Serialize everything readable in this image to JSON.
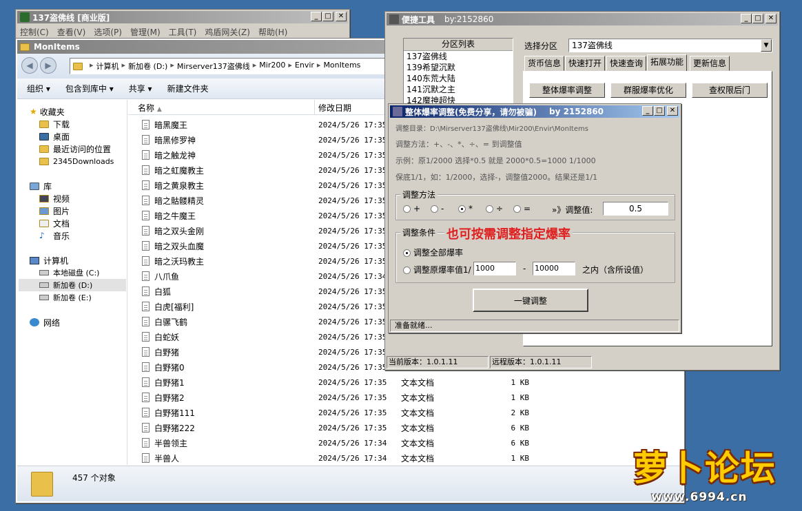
{
  "back_window": {
    "title": "137盗佛线 [商业版]",
    "menu": [
      "控制(C)",
      "查看(V)",
      "选项(P)",
      "管理(M)",
      "工具(T)",
      "鸡盾网关(Z)",
      "帮助(H)"
    ]
  },
  "explorer": {
    "title": "MonItems",
    "path": [
      "计算机",
      "新加卷 (D:)",
      "Mirserver137盗佛线",
      "Mir200",
      "Envir",
      "MonItems"
    ],
    "toolbar": {
      "organize": "组织",
      "include": "包含到库中",
      "share": "共享",
      "new_folder": "新建文件夹"
    },
    "col_name": "名称",
    "col_date": "修改日期",
    "nav": {
      "favorites": "收藏夹",
      "fav_items": [
        "下载",
        "桌面",
        "最近访问的位置",
        "2345Downloads"
      ],
      "libraries": "库",
      "lib_items": [
        "视频",
        "图片",
        "文档",
        "音乐"
      ],
      "computer": "计算机",
      "drives": [
        "本地磁盘 (C:)",
        "新加卷 (D:)",
        "新加卷 (E:)"
      ],
      "network": "网络"
    },
    "files": [
      {
        "name": "暗黑魔王",
        "date": "2024/5/26 17:35",
        "type": "",
        "size": ""
      },
      {
        "name": "暗黑修罗神",
        "date": "2024/5/26 17:35",
        "type": "",
        "size": ""
      },
      {
        "name": "暗之触龙神",
        "date": "2024/5/26 17:35",
        "type": "",
        "size": ""
      },
      {
        "name": "暗之虹魔教主",
        "date": "2024/5/26 17:35",
        "type": "",
        "size": ""
      },
      {
        "name": "暗之黄泉教主",
        "date": "2024/5/26 17:35",
        "type": "",
        "size": ""
      },
      {
        "name": "暗之骷髅精灵",
        "date": "2024/5/26 17:35",
        "type": "",
        "size": ""
      },
      {
        "name": "暗之牛魔王",
        "date": "2024/5/26 17:35",
        "type": "",
        "size": ""
      },
      {
        "name": "暗之双头金刚",
        "date": "2024/5/26 17:35",
        "type": "",
        "size": ""
      },
      {
        "name": "暗之双头血魔",
        "date": "2024/5/26 17:35",
        "type": "",
        "size": ""
      },
      {
        "name": "暗之沃玛教主",
        "date": "2024/5/26 17:35",
        "type": "",
        "size": ""
      },
      {
        "name": "八爪鱼",
        "date": "2024/5/26 17:34",
        "type": "",
        "size": ""
      },
      {
        "name": "白狐",
        "date": "2024/5/26 17:35",
        "type": "",
        "size": ""
      },
      {
        "name": "白虎[福利]",
        "date": "2024/5/26 17:35",
        "type": "",
        "size": ""
      },
      {
        "name": "白骡飞鹤",
        "date": "2024/5/26 17:35",
        "type": "",
        "size": ""
      },
      {
        "name": "白蛇妖",
        "date": "2024/5/26 17:35",
        "type": "",
        "size": ""
      },
      {
        "name": "白野猪",
        "date": "2024/5/26 17:35",
        "type": "",
        "size": ""
      },
      {
        "name": "白野猪0",
        "date": "2024/5/26 17:35",
        "type": "",
        "size": ""
      },
      {
        "name": "白野猪1",
        "date": "2024/5/26 17:35",
        "type": "文本文档",
        "size": "1 KB"
      },
      {
        "name": "白野猪2",
        "date": "2024/5/26 17:35",
        "type": "文本文档",
        "size": "1 KB"
      },
      {
        "name": "白野猪111",
        "date": "2024/5/26 17:35",
        "type": "文本文档",
        "size": "2 KB"
      },
      {
        "name": "白野猪222",
        "date": "2024/5/26 17:35",
        "type": "文本文档",
        "size": "6 KB"
      },
      {
        "name": "半兽领主",
        "date": "2024/5/26 17:34",
        "type": "文本文档",
        "size": "6 KB"
      },
      {
        "name": "半兽人",
        "date": "2024/5/26 17:34",
        "type": "文本文档",
        "size": "1 KB"
      }
    ],
    "status_count": "457 个对象"
  },
  "tools": {
    "title": "便捷工具",
    "author": "by:2152860",
    "partition_header": "分区列表",
    "partitions": [
      "137盗佛线",
      "139希望沉默",
      "140东荒大陆",
      "141沉默之主",
      "142魔神超快"
    ],
    "select_label": "选择分区",
    "select_value": "137盗佛线",
    "tabs": [
      "货币信息",
      "快速打开",
      "快速查询",
      "拓展功能",
      "更新信息"
    ],
    "buttons": [
      "整体爆率调整",
      "群服爆率优化",
      "查权限后门"
    ],
    "status_current": "当前版本：1.0.1.11",
    "status_remote": "远程版本：1.0.1.11"
  },
  "dialog": {
    "title": "整体爆率调整(免费分享，请勿被骗)",
    "author": "by 2152860",
    "info_dir": "调整目录：D:\\Mirserver137盗佛线\\Mir200\\Envir\\MonItems",
    "info_method": "调整方法：+、-、*、÷、=  到调整值",
    "info_example": "示例：原1/2000 选择*0.5 就是 2000*0.5=1000  1/1000",
    "info_keep": "保底1/1，如：1/2000，选择-，调整值2000。结果还是1/1",
    "method_group": "调整方法",
    "ops": [
      "+",
      "-",
      "*",
      "÷",
      "="
    ],
    "op_selected": "*",
    "value_label": "»》调整值:",
    "value": "0.5",
    "cond_group": "调整条件",
    "annotation": "也可按需调整指定爆率",
    "cond_all": "调整全部爆率",
    "cond_range": "调整原爆率值1/",
    "range_from": "1000",
    "range_dash": "-",
    "range_to": "10000",
    "range_suffix": "之内（含所设值）",
    "run_button": "一键调整",
    "status": "准备就绪..."
  },
  "watermark": {
    "brand": "萝卜论坛",
    "url": "www.6994.cn"
  },
  "colors": {
    "desktop": "#3a6ea5",
    "annotation": "#e02020",
    "title_active": "#0a246a"
  }
}
